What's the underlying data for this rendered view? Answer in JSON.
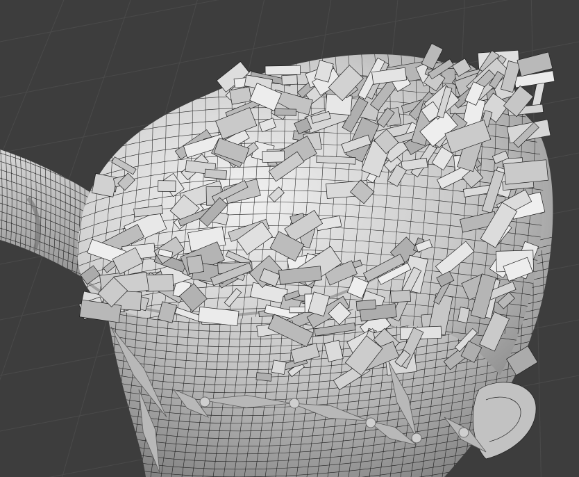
{
  "viewport": {
    "background": "#3d3d3d",
    "grid_color": "#4a4a4a",
    "shading": "solid",
    "wireframe_overlay": true
  },
  "model": {
    "surface_light": "#e6e6e6",
    "surface_mid": "#bdbdbd",
    "surface_dark": "#8a8a8a",
    "wire_color": "#1e1e1e",
    "joint_color": "#cfcfcf"
  }
}
